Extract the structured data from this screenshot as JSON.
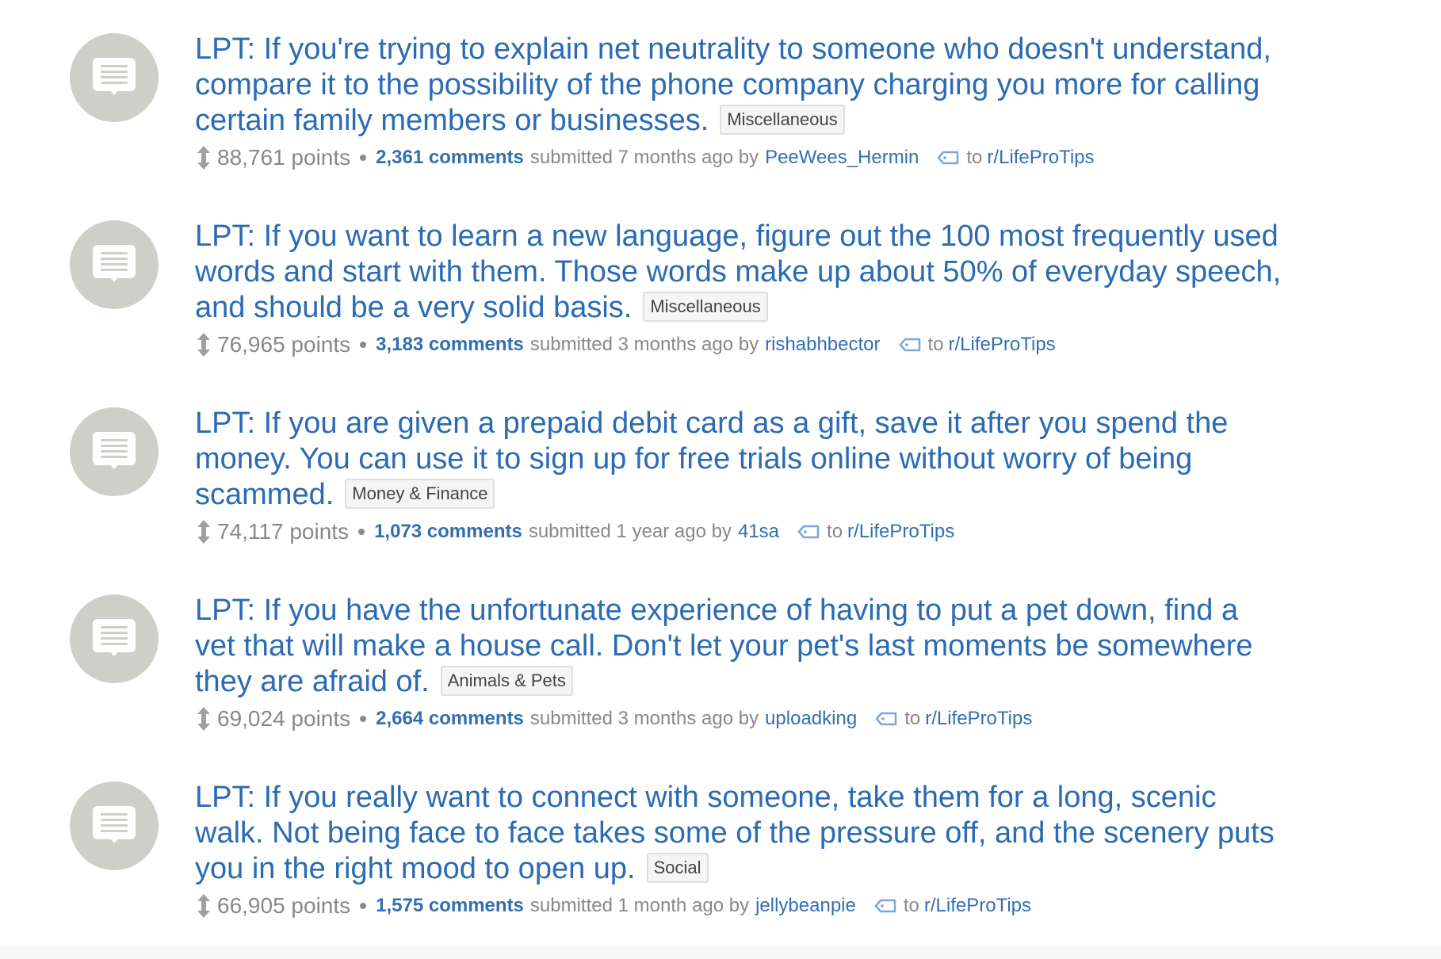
{
  "posts": [
    {
      "title_lines": [
        "LPT: If you're trying to explain net neutrality to someone who doesn't understand,",
        "compare it to the possibility of the phone company charging you more for calling",
        "certain family members or businesses."
      ],
      "flair": "Miscellaneous",
      "points": "88,761",
      "points_label": "points",
      "comments": "2,361 comments",
      "submitted": "submitted 7 months ago by",
      "author": "PeeWees_Hermin",
      "to": "to",
      "subreddit": "r/LifeProTips",
      "thumbnail_icon": "text-post-icon"
    },
    {
      "title_lines": [
        "LPT: If you want to learn a new language, figure out the 100 most frequently used",
        "words and start with them. Those words make up about 50% of everyday speech,",
        "and should be a very solid basis."
      ],
      "flair": "Miscellaneous",
      "points": "76,965",
      "points_label": "points",
      "comments": "3,183 comments",
      "submitted": "submitted 3 months ago by",
      "author": "rishabhbector",
      "to": "to",
      "subreddit": "r/LifeProTips",
      "thumbnail_icon": "text-post-icon"
    },
    {
      "title_lines": [
        "LPT: If you are given a prepaid debit card as a gift, save it after you spend the",
        "money. You can use it to sign up for free trials online without worry of being",
        "scammed."
      ],
      "flair": "Money & Finance",
      "points": "74,117",
      "points_label": "points",
      "comments": "1,073 comments",
      "submitted": "submitted 1 year ago by",
      "author": "41sa",
      "to": "to",
      "subreddit": "r/LifeProTips",
      "thumbnail_icon": "text-post-icon"
    },
    {
      "title_lines": [
        "LPT: If you have the unfortunate experience of having to put a pet down, find a",
        "vet that will make a house call. Don't let your pet's last moments be somewhere",
        "they are afraid of."
      ],
      "flair": "Animals & Pets",
      "points": "69,024",
      "points_label": "points",
      "comments": "2,664 comments",
      "submitted": "submitted 3 months ago by",
      "author": "uploadking",
      "to": "to",
      "subreddit": "r/LifeProTips",
      "thumbnail_icon": "text-post-icon"
    },
    {
      "title_lines": [
        "LPT: If you really want to connect with someone, take them for a long, scenic",
        "walk. Not being face to face takes some of the pressure off, and the scenery puts",
        "you in the right mood to open up."
      ],
      "flair": "Social",
      "points": "66,905",
      "points_label": "points",
      "comments": "1,575 comments",
      "submitted": "submitted 1 month ago by",
      "author": "jellybeanpie",
      "to": "to",
      "subreddit": "r/LifeProTips",
      "thumbnail_icon": "text-post-icon"
    }
  ],
  "icons": {
    "vote": "vote-arrows-icon",
    "subreddit_tag": "tag-icon"
  },
  "colors": {
    "link": "#2a6bb4",
    "meta_link": "#336fb0",
    "meta_text": "#888888",
    "thumbnail_bg": "#cfcfca"
  }
}
